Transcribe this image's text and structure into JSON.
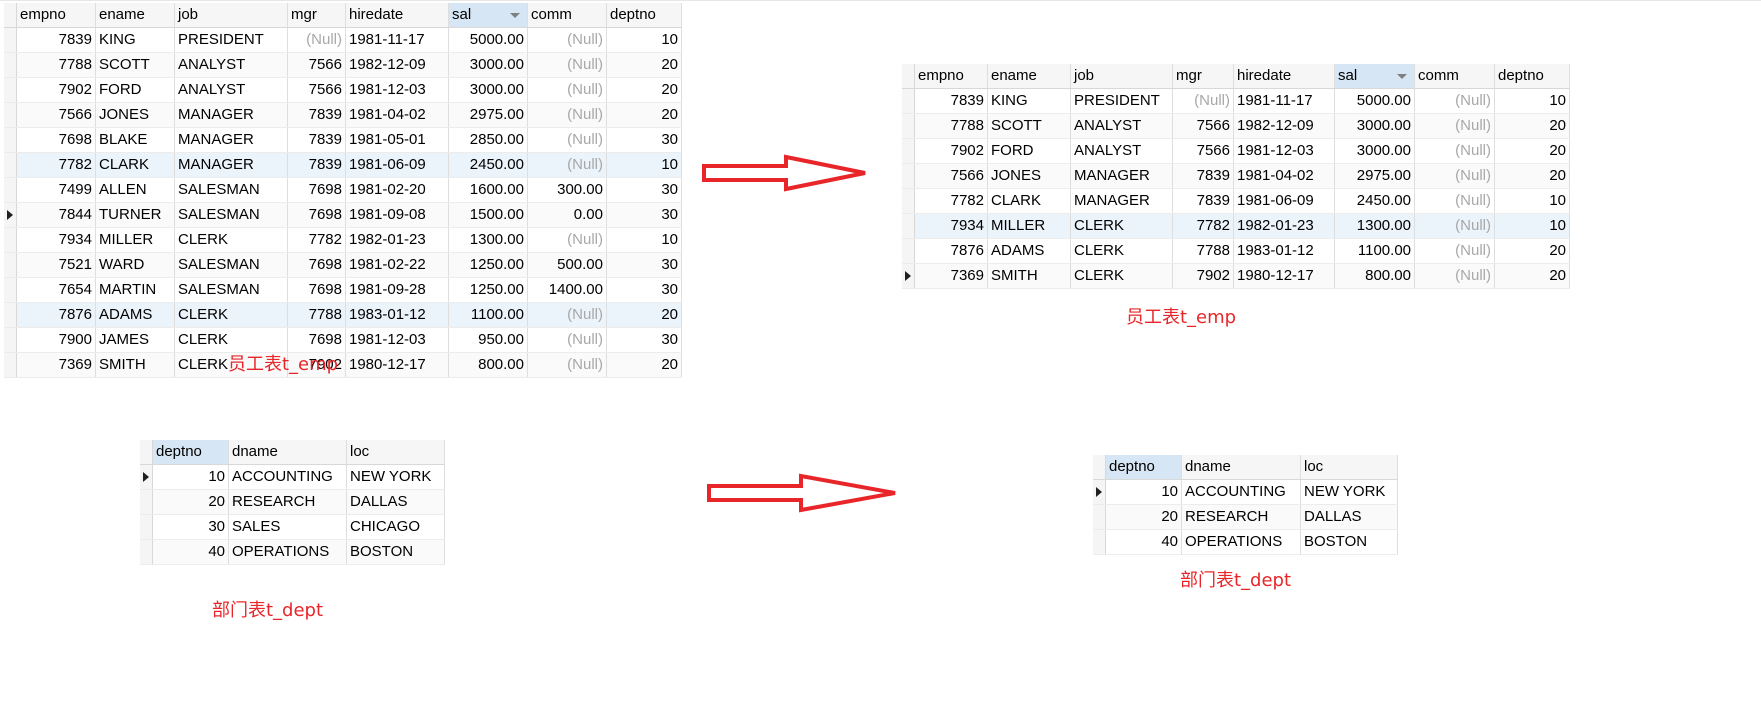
{
  "emp_columns": [
    "empno",
    "ename",
    "job",
    "mgr",
    "hiredate",
    "sal",
    "comm",
    "deptno"
  ],
  "emp_left_rows": [
    [
      "7839",
      "KING",
      "PRESIDENT",
      "(Null)",
      "1981-11-17",
      "5000.00",
      "(Null)",
      "10"
    ],
    [
      "7788",
      "SCOTT",
      "ANALYST",
      "7566",
      "1982-12-09",
      "3000.00",
      "(Null)",
      "20"
    ],
    [
      "7902",
      "FORD",
      "ANALYST",
      "7566",
      "1981-12-03",
      "3000.00",
      "(Null)",
      "20"
    ],
    [
      "7566",
      "JONES",
      "MANAGER",
      "7839",
      "1981-04-02",
      "2975.00",
      "(Null)",
      "20"
    ],
    [
      "7698",
      "BLAKE",
      "MANAGER",
      "7839",
      "1981-05-01",
      "2850.00",
      "(Null)",
      "30"
    ],
    [
      "7782",
      "CLARK",
      "MANAGER",
      "7839",
      "1981-06-09",
      "2450.00",
      "(Null)",
      "10"
    ],
    [
      "7499",
      "ALLEN",
      "SALESMAN",
      "7698",
      "1981-02-20",
      "1600.00",
      "300.00",
      "30"
    ],
    [
      "7844",
      "TURNER",
      "SALESMAN",
      "7698",
      "1981-09-08",
      "1500.00",
      "0.00",
      "30"
    ],
    [
      "7934",
      "MILLER",
      "CLERK",
      "7782",
      "1982-01-23",
      "1300.00",
      "(Null)",
      "10"
    ],
    [
      "7521",
      "WARD",
      "SALESMAN",
      "7698",
      "1981-02-22",
      "1250.00",
      "500.00",
      "30"
    ],
    [
      "7654",
      "MARTIN",
      "SALESMAN",
      "7698",
      "1981-09-28",
      "1250.00",
      "1400.00",
      "30"
    ],
    [
      "7876",
      "ADAMS",
      "CLERK",
      "7788",
      "1983-01-12",
      "1100.00",
      "(Null)",
      "20"
    ],
    [
      "7900",
      "JAMES",
      "CLERK",
      "7698",
      "1981-12-03",
      "950.00",
      "(Null)",
      "30"
    ],
    [
      "7369",
      "SMITH",
      "CLERK",
      "7902",
      "1980-12-17",
      "800.00",
      "(Null)",
      "20"
    ]
  ],
  "emp_right_rows": [
    [
      "7839",
      "KING",
      "PRESIDENT",
      "(Null)",
      "1981-11-17",
      "5000.00",
      "(Null)",
      "10"
    ],
    [
      "7788",
      "SCOTT",
      "ANALYST",
      "7566",
      "1982-12-09",
      "3000.00",
      "(Null)",
      "20"
    ],
    [
      "7902",
      "FORD",
      "ANALYST",
      "7566",
      "1981-12-03",
      "3000.00",
      "(Null)",
      "20"
    ],
    [
      "7566",
      "JONES",
      "MANAGER",
      "7839",
      "1981-04-02",
      "2975.00",
      "(Null)",
      "20"
    ],
    [
      "7782",
      "CLARK",
      "MANAGER",
      "7839",
      "1981-06-09",
      "2450.00",
      "(Null)",
      "10"
    ],
    [
      "7934",
      "MILLER",
      "CLERK",
      "7782",
      "1982-01-23",
      "1300.00",
      "(Null)",
      "10"
    ],
    [
      "7876",
      "ADAMS",
      "CLERK",
      "7788",
      "1983-01-12",
      "1100.00",
      "(Null)",
      "20"
    ],
    [
      "7369",
      "SMITH",
      "CLERK",
      "7902",
      "1980-12-17",
      "800.00",
      "(Null)",
      "20"
    ]
  ],
  "dept_columns": [
    "deptno",
    "dname",
    "loc"
  ],
  "dept_left_rows": [
    [
      "10",
      "ACCOUNTING",
      "NEW YORK"
    ],
    [
      "20",
      "RESEARCH",
      "DALLAS"
    ],
    [
      "30",
      "SALES",
      "CHICAGO"
    ],
    [
      "40",
      "OPERATIONS",
      "BOSTON"
    ]
  ],
  "dept_right_rows": [
    [
      "10",
      "ACCOUNTING",
      "NEW YORK"
    ],
    [
      "20",
      "RESEARCH",
      "DALLAS"
    ],
    [
      "40",
      "OPERATIONS",
      "BOSTON"
    ]
  ],
  "captions": {
    "emp_left": "员工表t_emp",
    "emp_right": "员工表t_emp",
    "dept_left": "部门表t_dept",
    "dept_right": "部门表t_dept"
  },
  "icons": {
    "transform_arrow": "right-arrow-icon",
    "row_indicator": "current-row-indicator-icon",
    "sort_indicator": "sort-descending-icon"
  },
  "colors": {
    "caption": "#e8262a",
    "arrow": "#e8262a",
    "null_text": "#a8a8a8",
    "selected_header": "#d7e6f5"
  }
}
